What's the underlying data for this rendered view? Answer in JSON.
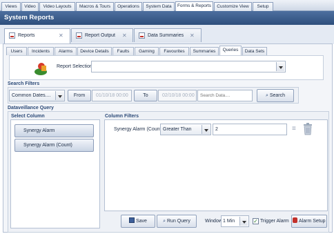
{
  "menu": [
    "Views",
    "Video",
    "Video Layouts",
    "Macros & Tours",
    "Operations",
    "System Data",
    "Forms & Reports",
    "Customize View",
    "Setup"
  ],
  "title": "System Reports",
  "main_tabs": [
    {
      "label": "Reports",
      "close": "✕"
    },
    {
      "label": "Report Output",
      "close": "✕"
    },
    {
      "label": "Data Summaries",
      "close": "✕"
    }
  ],
  "sub_tabs": [
    "Users",
    "Incidents",
    "Alarms",
    "Device Details",
    "Faults",
    "Gaming",
    "Favourites",
    "Summaries",
    "Queries",
    "Data Sets"
  ],
  "report_selection": {
    "label": "Report Selection",
    "value": ""
  },
  "search_filters": {
    "title": "Search Filters",
    "dates_combo": "Common Dates....",
    "from_label": "From",
    "from_value": "01/10/18 00:00",
    "to_label": "To",
    "to_value": "02/10/18 00:00",
    "search_placeholder": "Search Data....",
    "search_button": "Search"
  },
  "query": {
    "title": "Dataveillance Query",
    "select_column_title": "Select Column",
    "columns": [
      "Synergy Alarm",
      "Synergy Alarm (Count)"
    ],
    "column_filters_title": "Column Filters",
    "filter": {
      "column": "Synergy Alarm (Count)",
      "operator": "Greater Than",
      "value": "2"
    }
  },
  "footer": {
    "save": "Save",
    "run_query": "Run Query",
    "window_label": "Window",
    "window_value": "1 Min",
    "trigger_alarm": "Trigger Alarm",
    "trigger_checked": true,
    "alarm_setup": "Alarm Setup"
  }
}
